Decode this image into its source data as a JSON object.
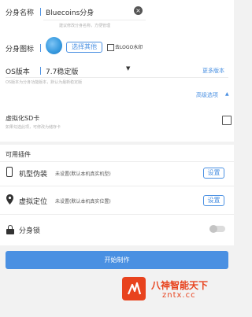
{
  "clone": {
    "name_label": "分身名称",
    "name_value": "Bluecoins分身",
    "name_hint": "建议修改分身名称，方便管理",
    "icon_label": "分身图标",
    "choose_other_label": "选择其他",
    "remove_logo_label": "去LOGO水印",
    "os_label": "OS版本",
    "os_value": "7.7稳定版",
    "more_versions_label": "更多版本",
    "os_hint": "OS版本为分身功能版本，默认为最新稳定版",
    "advanced_label": "高级选项"
  },
  "virtual_sd": {
    "label": "虚拟化SD卡",
    "hint": "如果勾选此项，可修改为储存卡"
  },
  "plugins": {
    "title": "可用插件",
    "items": [
      {
        "name": "机型伪装",
        "status": "未设置(默认本机真实机型)",
        "button": "设置"
      },
      {
        "name": "虚拟定位",
        "status": "未设置(默认本机真实位置)",
        "button": "设置"
      }
    ],
    "lock_label": "分身锁"
  },
  "start_button_label": "开始制作",
  "watermark": {
    "title": "八神智能天下",
    "url": "zntx.cc"
  },
  "colors": {
    "accent": "#4a90e2",
    "start_button": "#4a90e2",
    "watermark_orange": "#e8431e"
  }
}
